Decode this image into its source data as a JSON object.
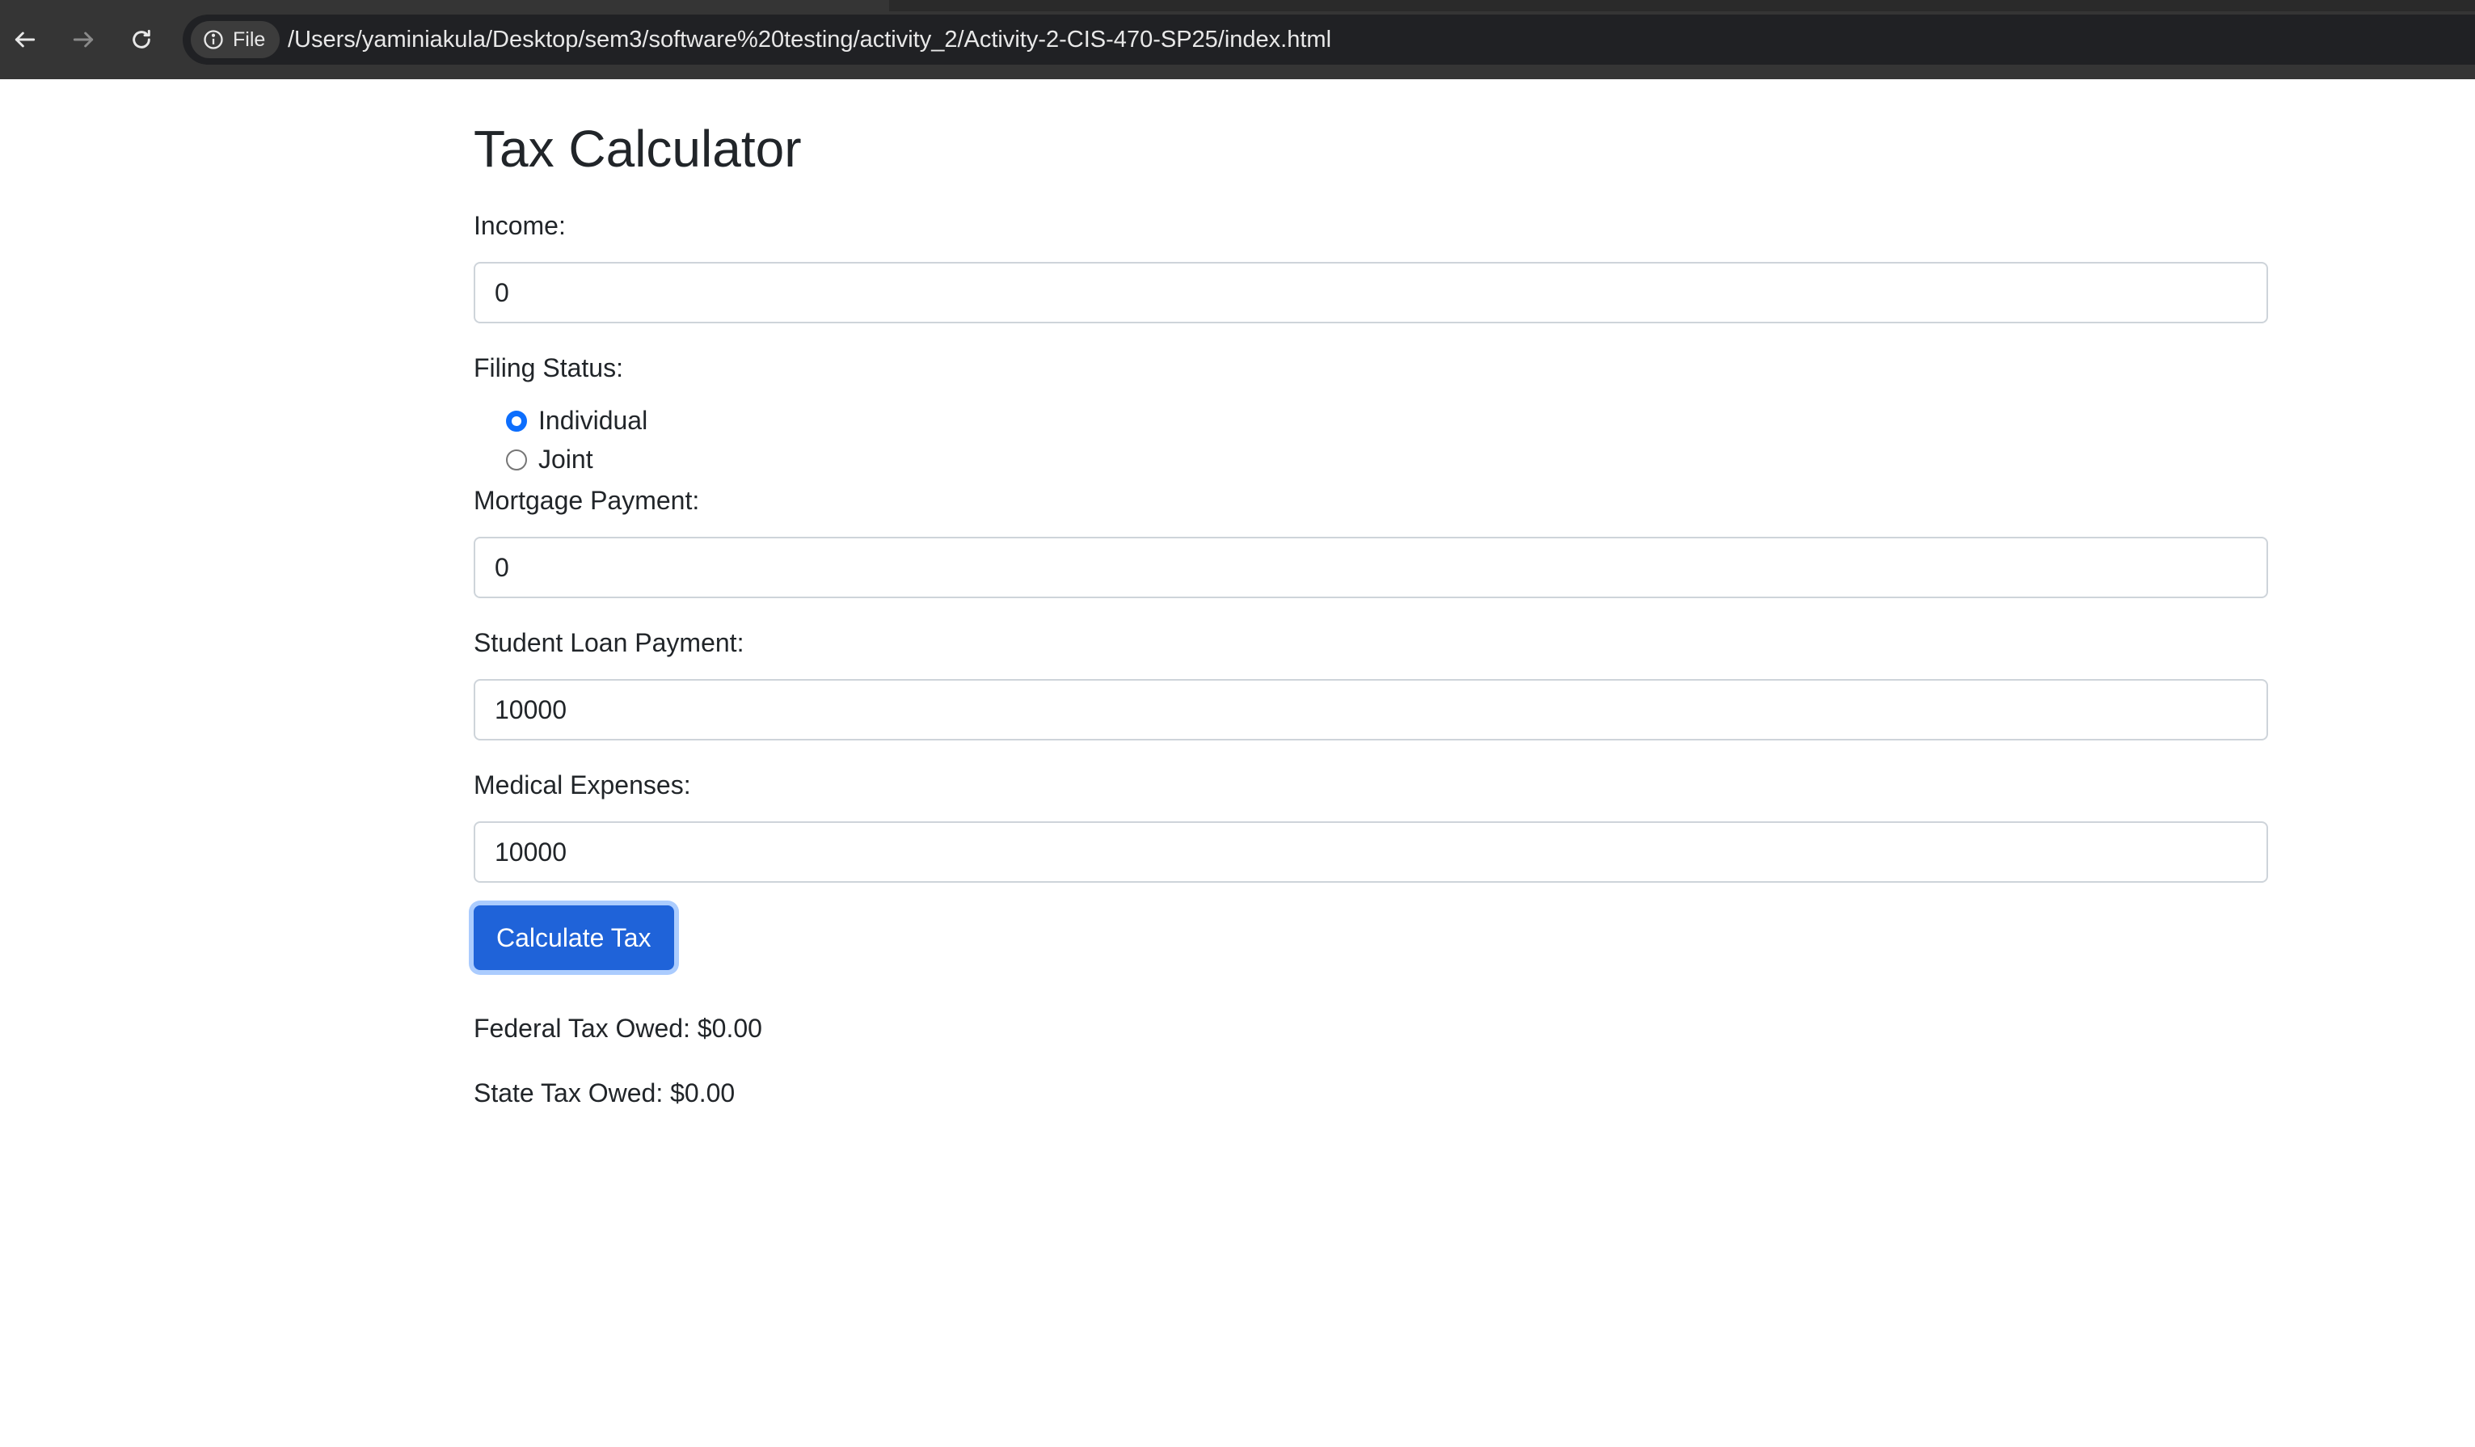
{
  "browser": {
    "back_icon": "arrow-left-icon",
    "forward_icon": "arrow-right-icon",
    "reload_icon": "reload-icon",
    "site_info_icon": "info-icon",
    "site_chip_label": "File",
    "url": "/Users/yaminiakula/Desktop/sem3/software%20testing/activity_2/Activity-2-CIS-470-SP25/index.html"
  },
  "page": {
    "title": "Tax Calculator"
  },
  "form": {
    "income": {
      "label": "Income:",
      "value": "0"
    },
    "filing_status": {
      "label": "Filing Status:",
      "options": [
        {
          "label": "Individual",
          "checked": true
        },
        {
          "label": "Joint",
          "checked": false
        }
      ]
    },
    "mortgage": {
      "label": "Mortgage Payment:",
      "value": "0"
    },
    "student_loan": {
      "label": "Student Loan Payment:",
      "value": "10000"
    },
    "medical": {
      "label": "Medical Expenses:",
      "value": "10000"
    },
    "submit_label": "Calculate Tax"
  },
  "results": {
    "federal": "Federal Tax Owed: $0.00",
    "state": "State Tax Owed: $0.00"
  },
  "colors": {
    "primary": "#1f63d9",
    "chrome_bg": "#353535"
  }
}
